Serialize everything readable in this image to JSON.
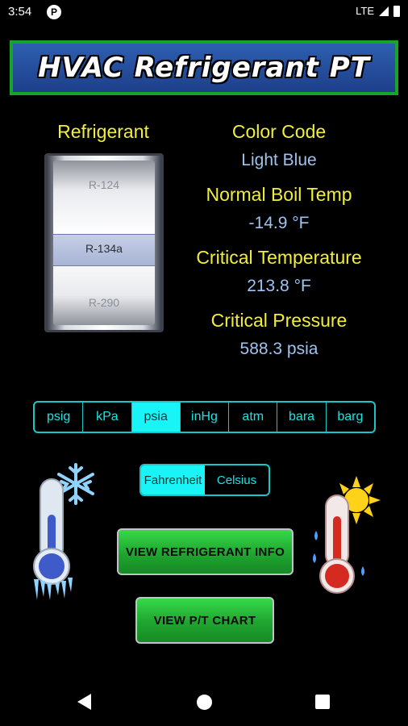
{
  "status_bar": {
    "time": "3:54",
    "badge": "P",
    "network": "LTE"
  },
  "title": "HVAC Refrigerant PT",
  "refrigerant": {
    "label": "Refrigerant",
    "picker": {
      "above": "R-124",
      "selected": "R-134a",
      "below": "R-290"
    }
  },
  "properties": {
    "color_code_label": "Color Code",
    "color_code_value": "Light Blue",
    "boil_label": "Normal Boil Temp",
    "boil_value": "-14.9 °F",
    "crit_temp_label": "Critical Temperature",
    "crit_temp_value": "213.8 °F",
    "crit_pressure_label": "Critical Pressure",
    "crit_pressure_value": "588.3 psia"
  },
  "units": {
    "items": [
      "psig",
      "kPa",
      "psia",
      "inHg",
      "atm",
      "bara",
      "barg"
    ],
    "selected": "psia"
  },
  "temperature_toggle": {
    "fahrenheit": "Fahrenheit",
    "celsius": "Celsius",
    "selected": "Fahrenheit"
  },
  "buttons": {
    "info": "VIEW REFRIGERANT INFO",
    "chart": "VIEW P/T CHART"
  },
  "icons": {
    "cold": "cold-thermometer-icon",
    "hot": "hot-thermometer-icon"
  },
  "colors": {
    "label": "#f1ee3a",
    "value": "#9ec3ef",
    "accent": "#19f4f6",
    "button": "#1fa52f",
    "banner_border": "#1aa32a"
  }
}
